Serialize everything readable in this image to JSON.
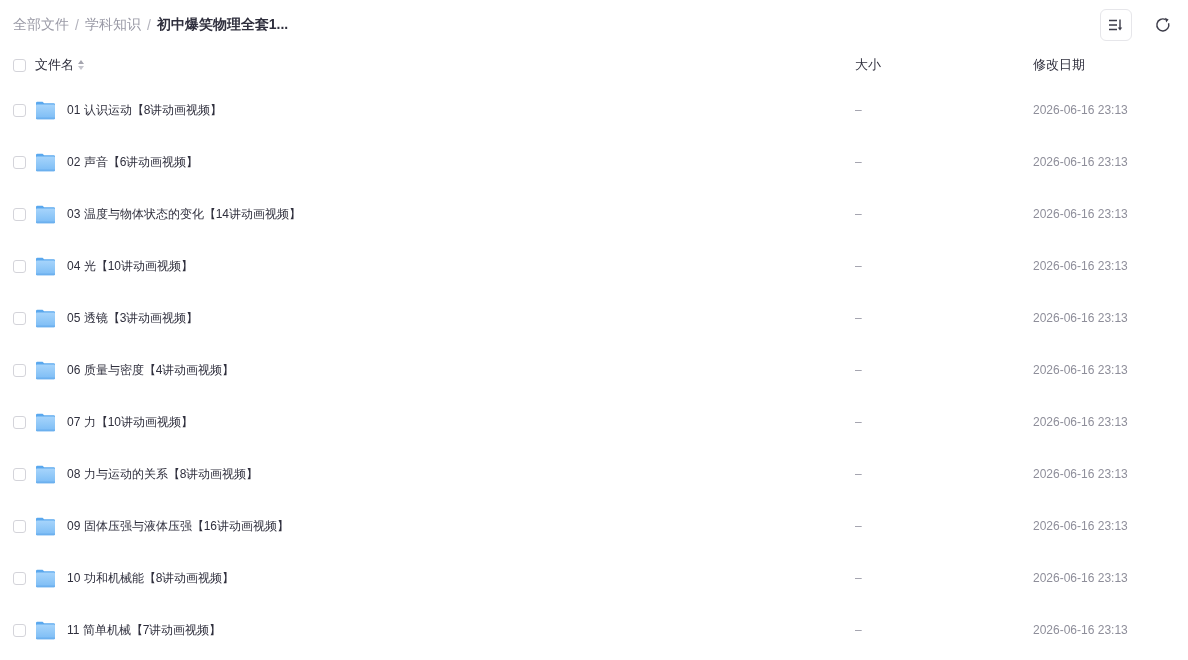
{
  "breadcrumb": [
    {
      "kind": "link",
      "label": "全部文件"
    },
    {
      "kind": "separator",
      "label": "/"
    },
    {
      "kind": "link",
      "label": "学科知识"
    },
    {
      "kind": "separator",
      "label": "/"
    },
    {
      "kind": "current",
      "label": "初中爆笑物理全套1..."
    }
  ],
  "table": {
    "select_all": {
      "checked": false
    },
    "columns": [
      "文件名",
      "大小",
      "修改日期"
    ],
    "rows": [
      {
        "name": "01 认识运动【8讲动画视频】",
        "size": "–",
        "modified": "2026-06-16 23:13",
        "checked": false
      },
      {
        "name": "02 声音【6讲动画视频】",
        "size": "–",
        "modified": "2026-06-16 23:13",
        "checked": false
      },
      {
        "name": "03 温度与物体状态的变化【14讲动画视频】",
        "size": "–",
        "modified": "2026-06-16 23:13",
        "checked": false
      },
      {
        "name": "04 光【10讲动画视频】",
        "size": "–",
        "modified": "2026-06-16 23:13",
        "checked": false
      },
      {
        "name": "05 透镜【3讲动画视频】",
        "size": "–",
        "modified": "2026-06-16 23:13",
        "checked": false
      },
      {
        "name": "06 质量与密度【4讲动画视频】",
        "size": "–",
        "modified": "2026-06-16 23:13",
        "checked": false
      },
      {
        "name": "07 力【10讲动画视频】",
        "size": "–",
        "modified": "2026-06-16 23:13",
        "checked": false
      },
      {
        "name": "08 力与运动的关系【8讲动画视频】",
        "size": "–",
        "modified": "2026-06-16 23:13",
        "checked": false
      },
      {
        "name": "09 固体压强与液体压强【16讲动画视频】",
        "size": "–",
        "modified": "2026-06-16 23:13",
        "checked": false
      },
      {
        "name": "10 功和机械能【8讲动画视频】",
        "size": "–",
        "modified": "2026-06-16 23:13",
        "checked": false
      },
      {
        "name": "11 简单机械【7讲动画视频】",
        "size": "–",
        "modified": "2026-06-16 23:13",
        "checked": false
      }
    ]
  }
}
